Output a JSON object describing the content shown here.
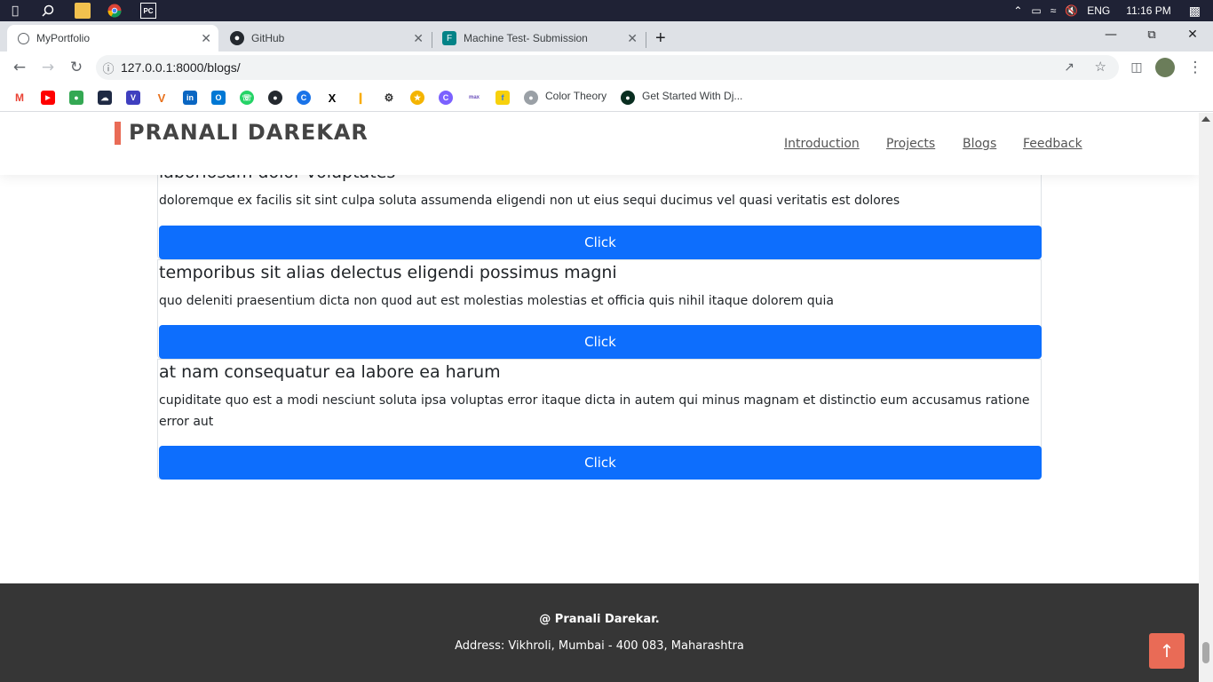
{
  "taskbar": {
    "language": "ENG",
    "time": "11:16 PM"
  },
  "tabs": [
    {
      "title": "MyPortfolio",
      "icon": "globe-icon",
      "active": true
    },
    {
      "title": "GitHub",
      "icon": "github-icon",
      "active": false
    },
    {
      "title": "Machine Test- Submission",
      "icon": "forms-icon",
      "active": false
    }
  ],
  "toolbar": {
    "url": "127.0.0.1:8000/blogs/"
  },
  "bookmarks": {
    "named": [
      {
        "label": "Color Theory",
        "icon": "color-theory-icon"
      },
      {
        "label": "Get Started With Dj...",
        "icon": "django-icon"
      }
    ]
  },
  "site": {
    "logo": "PRANALI DAREKAR",
    "nav": [
      "Introduction",
      "Projects",
      "Blogs",
      "Feedback"
    ],
    "colors": {
      "accent": "#e96b56",
      "button": "#0d6efd",
      "footer": "#363636"
    }
  },
  "blogs": [
    {
      "title": "laboriosam dolor voluptates",
      "text": "doloremque ex facilis sit sint culpa soluta assumenda eligendi non ut eius sequi ducimus vel quasi veritatis est dolores",
      "button": "Click"
    },
    {
      "title": "temporibus sit alias delectus eligendi possimus magni",
      "text": "quo deleniti praesentium dicta non quod aut est molestias molestias et officia quis nihil itaque dolorem quia",
      "button": "Click"
    },
    {
      "title": "at nam consequatur ea labore ea harum",
      "text": "cupiditate quo est a modi nesciunt soluta ipsa voluptas error itaque dicta in autem qui minus magnam et distinctio eum accusamus ratione error aut",
      "button": "Click"
    }
  ],
  "footer": {
    "copyright": "@ Pranali Darekar.",
    "address": "Address: Vikhroli, Mumbai - 400 083, Maharashtra"
  }
}
